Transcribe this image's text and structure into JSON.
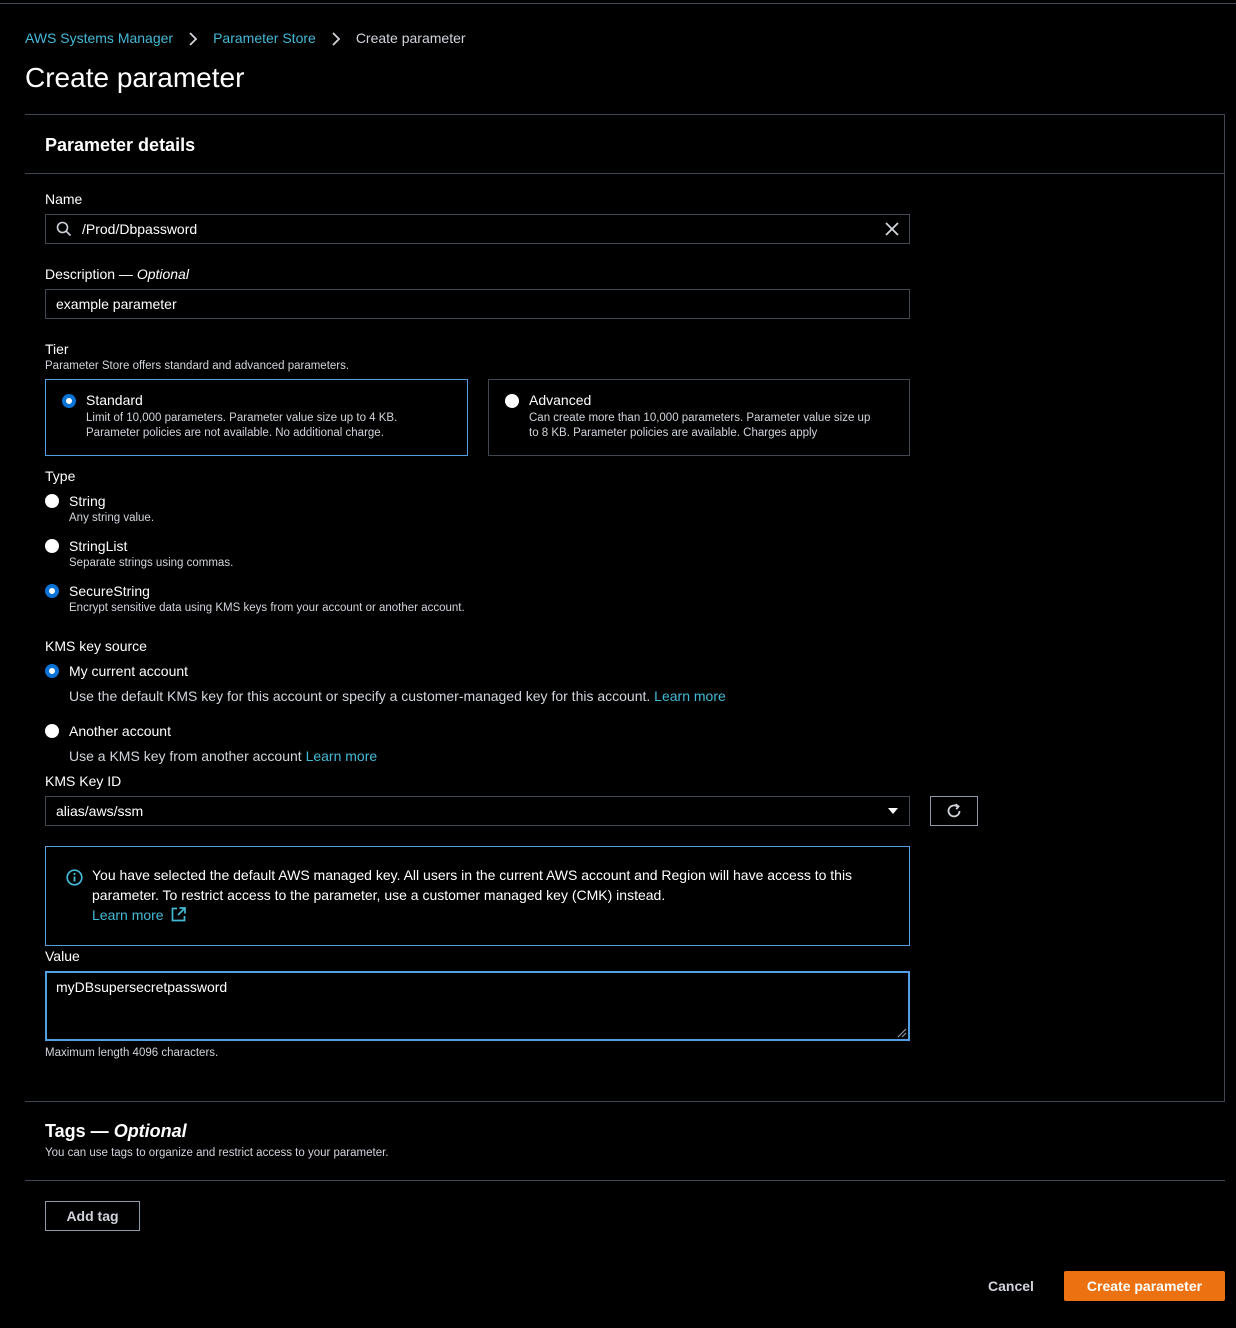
{
  "breadcrumb": {
    "items": [
      "AWS Systems Manager",
      "Parameter Store"
    ],
    "current": "Create parameter"
  },
  "page_title": "Create parameter",
  "details": {
    "heading": "Parameter details",
    "name": {
      "label": "Name",
      "value": "/Prod/Dbpassword"
    },
    "description": {
      "label": "Description — ",
      "optional": "Optional",
      "value": "example parameter"
    },
    "tier": {
      "label": "Tier",
      "hint": "Parameter Store offers standard and advanced parameters.",
      "options": [
        {
          "title": "Standard",
          "desc1": "Limit of 10,000 parameters. Parameter value size up to 4 KB.",
          "desc2": "Parameter policies are not available. No additional charge.",
          "selected": true
        },
        {
          "title": "Advanced",
          "desc1": "Can create more than 10,000 parameters. Parameter value size up",
          "desc2": "to 8 KB. Parameter policies are available. Charges apply",
          "selected": false
        }
      ]
    },
    "type": {
      "label": "Type",
      "options": [
        {
          "title": "String",
          "desc": "Any string value.",
          "selected": false
        },
        {
          "title": "StringList",
          "desc": "Separate strings using commas.",
          "selected": false
        },
        {
          "title": "SecureString",
          "desc": "Encrypt sensitive data using KMS keys from your account or another account.",
          "selected": true
        }
      ]
    },
    "kms_source": {
      "label": "KMS key source",
      "options": [
        {
          "title": "My current account",
          "desc": "Use the default KMS key for this account or specify a customer-managed key for this account.",
          "link": "Learn more",
          "selected": true
        },
        {
          "title": "Another account",
          "desc": "Use a KMS key from another account",
          "link": "Learn more",
          "selected": false
        }
      ]
    },
    "kms_key_id": {
      "label": "KMS Key ID",
      "value": "alias/aws/ssm"
    },
    "info": {
      "line1": "You have selected the default AWS managed key. All users in the current AWS account and Region will have access to this",
      "line2": "parameter. To restrict access to the parameter, use a customer managed key (CMK) instead.",
      "link": "Learn more"
    },
    "value": {
      "label": "Value",
      "value": "myDBsupersecretpassword",
      "hint": "Maximum length 4096 characters."
    }
  },
  "tags": {
    "heading": "Tags — ",
    "optional": "Optional",
    "hint": "You can use tags to organize and restrict access to your parameter.",
    "add_label": "Add tag"
  },
  "actions": {
    "cancel": "Cancel",
    "create": "Create parameter"
  },
  "colors": {
    "accent": "#0972d3",
    "link": "#44b9d6",
    "primary": "#ec7211",
    "info_border": "#539fe5"
  }
}
